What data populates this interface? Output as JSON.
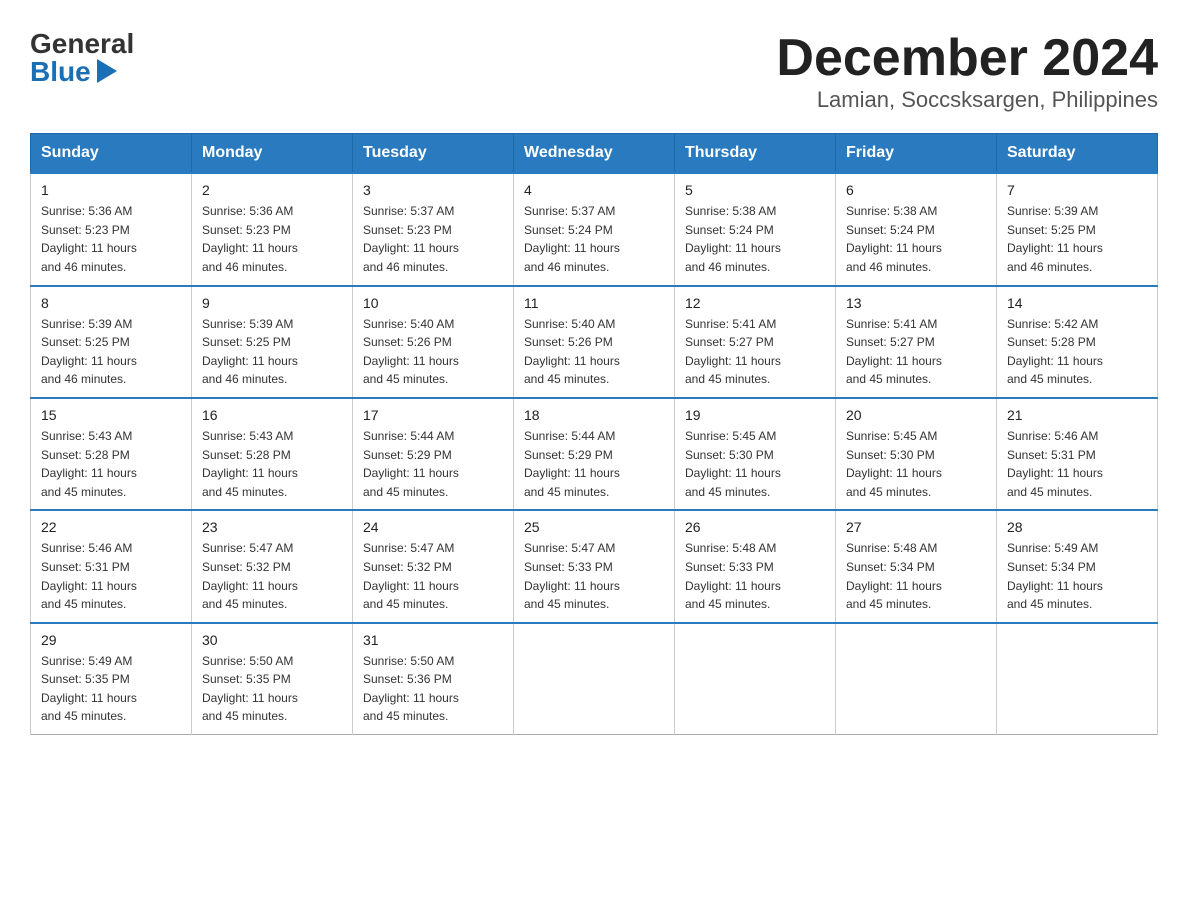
{
  "logo": {
    "general": "General",
    "blue": "Blue"
  },
  "title": "December 2024",
  "location": "Lamian, Soccsksargen, Philippines",
  "weekdays": [
    "Sunday",
    "Monday",
    "Tuesday",
    "Wednesday",
    "Thursday",
    "Friday",
    "Saturday"
  ],
  "weeks": [
    [
      {
        "day": "1",
        "sunrise": "5:36 AM",
        "sunset": "5:23 PM",
        "daylight": "11 hours and 46 minutes."
      },
      {
        "day": "2",
        "sunrise": "5:36 AM",
        "sunset": "5:23 PM",
        "daylight": "11 hours and 46 minutes."
      },
      {
        "day": "3",
        "sunrise": "5:37 AM",
        "sunset": "5:23 PM",
        "daylight": "11 hours and 46 minutes."
      },
      {
        "day": "4",
        "sunrise": "5:37 AM",
        "sunset": "5:24 PM",
        "daylight": "11 hours and 46 minutes."
      },
      {
        "day": "5",
        "sunrise": "5:38 AM",
        "sunset": "5:24 PM",
        "daylight": "11 hours and 46 minutes."
      },
      {
        "day": "6",
        "sunrise": "5:38 AM",
        "sunset": "5:24 PM",
        "daylight": "11 hours and 46 minutes."
      },
      {
        "day": "7",
        "sunrise": "5:39 AM",
        "sunset": "5:25 PM",
        "daylight": "11 hours and 46 minutes."
      }
    ],
    [
      {
        "day": "8",
        "sunrise": "5:39 AM",
        "sunset": "5:25 PM",
        "daylight": "11 hours and 46 minutes."
      },
      {
        "day": "9",
        "sunrise": "5:39 AM",
        "sunset": "5:25 PM",
        "daylight": "11 hours and 46 minutes."
      },
      {
        "day": "10",
        "sunrise": "5:40 AM",
        "sunset": "5:26 PM",
        "daylight": "11 hours and 45 minutes."
      },
      {
        "day": "11",
        "sunrise": "5:40 AM",
        "sunset": "5:26 PM",
        "daylight": "11 hours and 45 minutes."
      },
      {
        "day": "12",
        "sunrise": "5:41 AM",
        "sunset": "5:27 PM",
        "daylight": "11 hours and 45 minutes."
      },
      {
        "day": "13",
        "sunrise": "5:41 AM",
        "sunset": "5:27 PM",
        "daylight": "11 hours and 45 minutes."
      },
      {
        "day": "14",
        "sunrise": "5:42 AM",
        "sunset": "5:28 PM",
        "daylight": "11 hours and 45 minutes."
      }
    ],
    [
      {
        "day": "15",
        "sunrise": "5:43 AM",
        "sunset": "5:28 PM",
        "daylight": "11 hours and 45 minutes."
      },
      {
        "day": "16",
        "sunrise": "5:43 AM",
        "sunset": "5:28 PM",
        "daylight": "11 hours and 45 minutes."
      },
      {
        "day": "17",
        "sunrise": "5:44 AM",
        "sunset": "5:29 PM",
        "daylight": "11 hours and 45 minutes."
      },
      {
        "day": "18",
        "sunrise": "5:44 AM",
        "sunset": "5:29 PM",
        "daylight": "11 hours and 45 minutes."
      },
      {
        "day": "19",
        "sunrise": "5:45 AM",
        "sunset": "5:30 PM",
        "daylight": "11 hours and 45 minutes."
      },
      {
        "day": "20",
        "sunrise": "5:45 AM",
        "sunset": "5:30 PM",
        "daylight": "11 hours and 45 minutes."
      },
      {
        "day": "21",
        "sunrise": "5:46 AM",
        "sunset": "5:31 PM",
        "daylight": "11 hours and 45 minutes."
      }
    ],
    [
      {
        "day": "22",
        "sunrise": "5:46 AM",
        "sunset": "5:31 PM",
        "daylight": "11 hours and 45 minutes."
      },
      {
        "day": "23",
        "sunrise": "5:47 AM",
        "sunset": "5:32 PM",
        "daylight": "11 hours and 45 minutes."
      },
      {
        "day": "24",
        "sunrise": "5:47 AM",
        "sunset": "5:32 PM",
        "daylight": "11 hours and 45 minutes."
      },
      {
        "day": "25",
        "sunrise": "5:47 AM",
        "sunset": "5:33 PM",
        "daylight": "11 hours and 45 minutes."
      },
      {
        "day": "26",
        "sunrise": "5:48 AM",
        "sunset": "5:33 PM",
        "daylight": "11 hours and 45 minutes."
      },
      {
        "day": "27",
        "sunrise": "5:48 AM",
        "sunset": "5:34 PM",
        "daylight": "11 hours and 45 minutes."
      },
      {
        "day": "28",
        "sunrise": "5:49 AM",
        "sunset": "5:34 PM",
        "daylight": "11 hours and 45 minutes."
      }
    ],
    [
      {
        "day": "29",
        "sunrise": "5:49 AM",
        "sunset": "5:35 PM",
        "daylight": "11 hours and 45 minutes."
      },
      {
        "day": "30",
        "sunrise": "5:50 AM",
        "sunset": "5:35 PM",
        "daylight": "11 hours and 45 minutes."
      },
      {
        "day": "31",
        "sunrise": "5:50 AM",
        "sunset": "5:36 PM",
        "daylight": "11 hours and 45 minutes."
      },
      null,
      null,
      null,
      null
    ]
  ],
  "labels": {
    "sunrise": "Sunrise:",
    "sunset": "Sunset:",
    "daylight": "Daylight:"
  }
}
